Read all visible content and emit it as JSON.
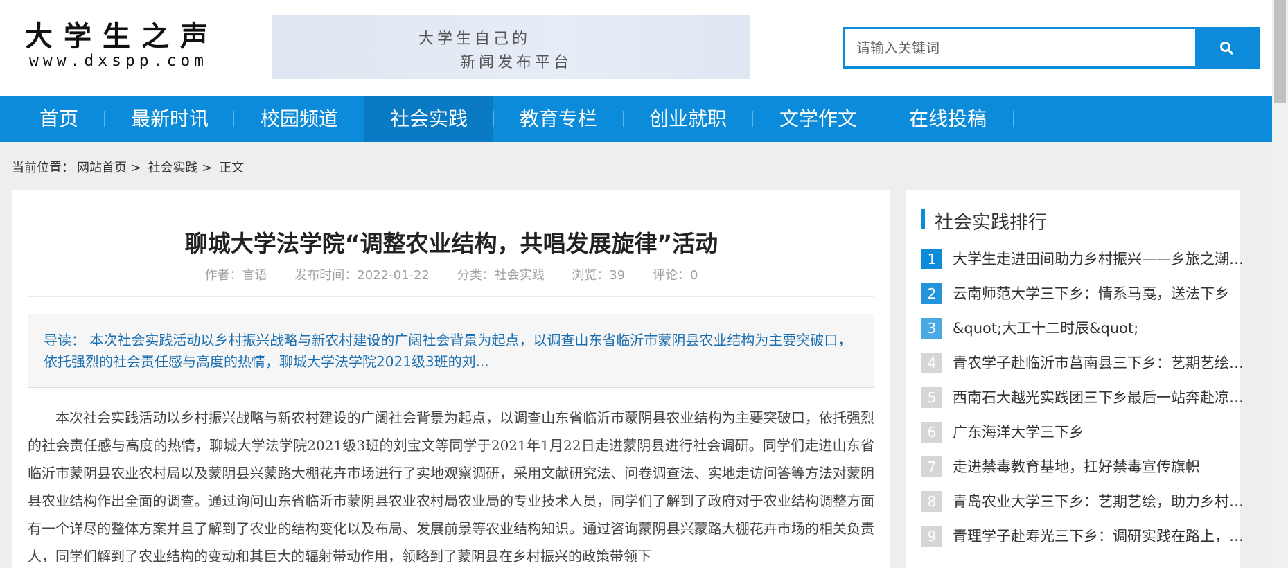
{
  "site": {
    "logo_title": "大学生之声",
    "logo_url": "www.dxspp.com",
    "banner_line1": "大学生自己的",
    "banner_line2": "新闻发布平台"
  },
  "search": {
    "placeholder": "请输入关键词",
    "button_icon": "search-icon"
  },
  "nav": {
    "items": [
      {
        "label": "首页"
      },
      {
        "label": "最新时讯"
      },
      {
        "label": "校园频道"
      },
      {
        "label": "社会实践",
        "active": true
      },
      {
        "label": "教育专栏"
      },
      {
        "label": "创业就职"
      },
      {
        "label": "文学作文"
      },
      {
        "label": "在线投稿"
      }
    ]
  },
  "breadcrumb": {
    "prefix": "当前位置：",
    "home": "网站首页",
    "sep": ">",
    "category": "社会实践",
    "current": "正文"
  },
  "article": {
    "title": "聊城大学法学院“调整农业结构，共唱发展旋律”活动",
    "meta": {
      "author": "作者：言语",
      "date": "发布时间：2022-01-22",
      "category": "分类：社会实践",
      "views": "浏览：39",
      "comments": "评论：0"
    },
    "summary": "导读： 本次社会实践活动以乡村振兴战略与新农村建设的广阔社会背景为起点，以调查山东省临沂市蒙阴县农业结构为主要突破口，依托强烈的社会责任感与高度的热情，聊城大学法学院2021级3班的刘...",
    "body": "本次社会实践活动以乡村振兴战略与新农村建设的广阔社会背景为起点，以调查山东省临沂市蒙阴县农业结构为主要突破口，依托强烈的社会责任感与高度的热情，聊城大学法学院2021级3班的刘宝文等同学于2021年1月22日走进蒙阴县进行社会调研。同学们走进山东省临沂市蒙阴县农业农村局以及蒙阴县兴蒙路大棚花卉市场进行了实地观察调研，采用文献研究法、问卷调查法、实地走访问答等方法对蒙阴县农业结构作出全面的调查。通过询问山东省临沂市蒙阴县农业农村局农业局的专业技术人员，同学们了解到了政府对于农业结构调整方面有一个详尽的整体方案并且了解到了农业的结构变化以及布局、发展前景等农业结构知识。通过咨询蒙阴县兴蒙路大棚花卉市场的相关负责人，同学们解到了农业结构的变动和其巨大的辐射带动作用，领略到了蒙阴县在乡村振兴的政策带领下"
  },
  "sidebar": {
    "title": "社会实践排行",
    "accent_color": "#0b8bd9",
    "items": [
      {
        "num": "1",
        "text": "大学生走进田间助力乡村振兴——乡旅之潮，振兴之路",
        "color": "#0b8bd9"
      },
      {
        "num": "2",
        "text": "云南师范大学三下乡：情系马戛，送法下乡",
        "color": "#2393db"
      },
      {
        "num": "3",
        "text": "&quot;大工十二时辰&quot;",
        "color": "#4aa8e3"
      },
      {
        "num": "4",
        "text": "青农学子赴临沂市莒南县三下乡：艺期艺绘，助力乡村振兴",
        "color": "#d6d6d6"
      },
      {
        "num": "5",
        "text": "西南石大越光实践团三下乡最后一站奔赴凉山州",
        "color": "#d6d6d6"
      },
      {
        "num": "6",
        "text": "广东海洋大学三下乡",
        "color": "#d6d6d6"
      },
      {
        "num": "7",
        "text": "走进禁毒教育基地，扛好禁毒宣传旗帜",
        "color": "#d6d6d6"
      },
      {
        "num": "8",
        "text": "青岛农业大学三下乡：艺期艺绘，助力乡村振兴",
        "color": "#d6d6d6"
      },
      {
        "num": "9",
        "text": "青理学子赴寿光三下乡：调研实践在路上，青春奋斗正当时",
        "color": "#d6d6d6"
      }
    ]
  }
}
